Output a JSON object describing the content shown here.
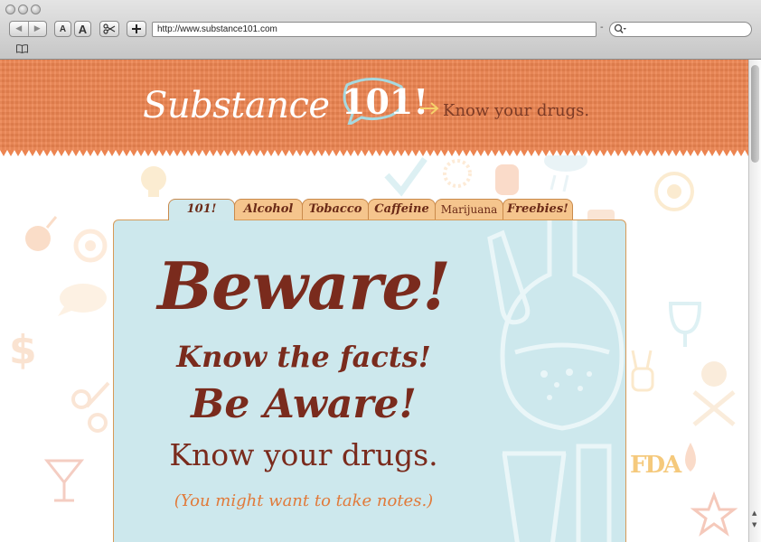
{
  "browser": {
    "url": "http://www.substance101.com",
    "font_smaller_label": "A",
    "font_larger_label": "A",
    "url_dash": "-"
  },
  "header": {
    "logo_word": "Substance",
    "logo_number": "101!",
    "tagline": "Know your drugs."
  },
  "tabs": [
    {
      "label": "101!",
      "active": true
    },
    {
      "label": "Alcohol",
      "active": false
    },
    {
      "label": "Tobacco",
      "active": false
    },
    {
      "label": "Caffeine",
      "active": false
    },
    {
      "label": "Marijuana",
      "active": false
    },
    {
      "label": "Freebies!",
      "active": false
    }
  ],
  "panel": {
    "line1": "Beware!",
    "line2": "Know the facts!",
    "line3": "Be Aware!",
    "line4": "Know your drugs.",
    "line5": "(You might want to take notes.)"
  },
  "footer_mark": "FDA",
  "colors": {
    "banner": "#ec8450",
    "panel": "#cde8ed",
    "headline": "#7a2b1d",
    "accent": "#e17a3a",
    "tab": "#f5c58d"
  }
}
